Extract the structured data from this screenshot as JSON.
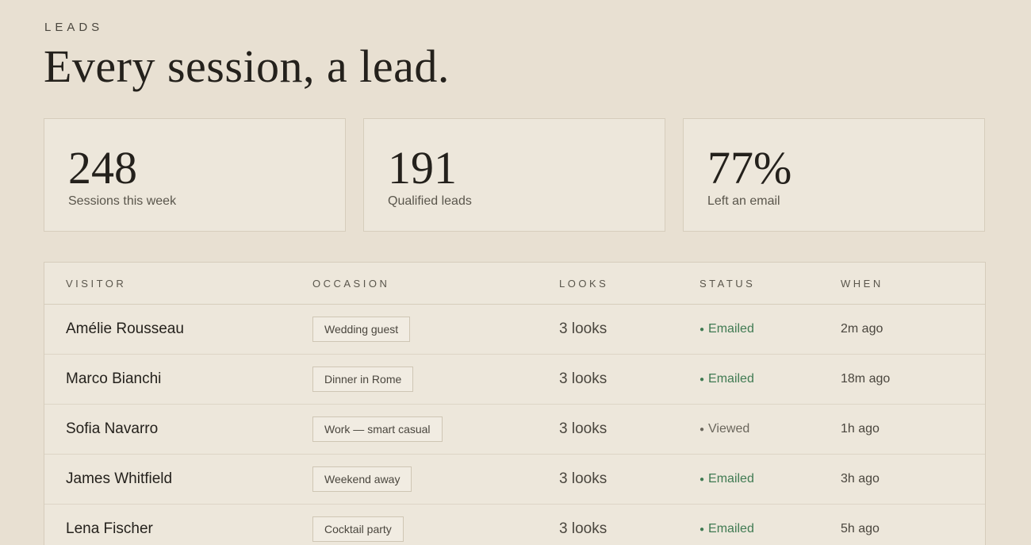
{
  "header": {
    "eyebrow": "LEADS",
    "title": "Every session, a lead."
  },
  "stats": [
    {
      "value": "248",
      "label": "Sessions this week"
    },
    {
      "value": "191",
      "label": "Qualified leads"
    },
    {
      "value": "77%",
      "label": "Left an email"
    }
  ],
  "colors": {
    "emailed": "#3f7a52",
    "viewed": "#6a665c"
  },
  "table": {
    "columns": [
      "VISITOR",
      "OCCASION",
      "LOOKS",
      "STATUS",
      "WHEN"
    ],
    "rows": [
      {
        "visitor": "Amélie Rousseau",
        "occasion": "Wedding guest",
        "looks": "3 looks",
        "status": "Emailed",
        "when": "2m ago"
      },
      {
        "visitor": "Marco Bianchi",
        "occasion": "Dinner in Rome",
        "looks": "3 looks",
        "status": "Emailed",
        "when": "18m ago"
      },
      {
        "visitor": "Sofia Navarro",
        "occasion": "Work — smart casual",
        "looks": "3 looks",
        "status": "Viewed",
        "when": "1h ago"
      },
      {
        "visitor": "James Whitfield",
        "occasion": "Weekend away",
        "looks": "3 looks",
        "status": "Emailed",
        "when": "3h ago"
      },
      {
        "visitor": "Lena Fischer",
        "occasion": "Cocktail party",
        "looks": "3 looks",
        "status": "Emailed",
        "when": "5h ago"
      }
    ]
  }
}
